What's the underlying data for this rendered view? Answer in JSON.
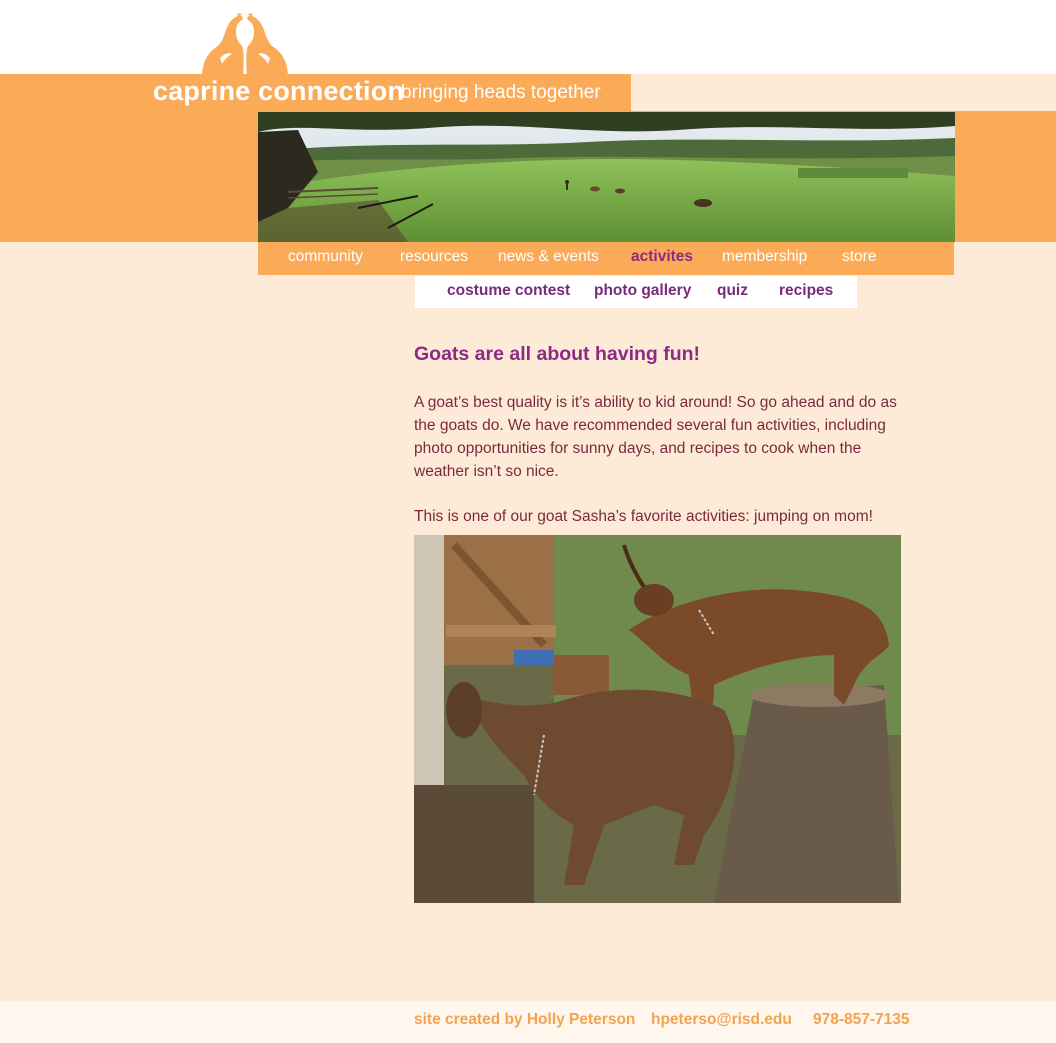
{
  "site": {
    "title": "caprine connection",
    "tagline": "bringing heads together",
    "logo_icon": "twin-goats-logo-icon"
  },
  "main_nav": {
    "items": [
      {
        "label": "community"
      },
      {
        "label": "resources"
      },
      {
        "label": "news & events"
      },
      {
        "label": "activites",
        "active": true
      },
      {
        "label": "membership"
      },
      {
        "label": "store"
      }
    ]
  },
  "sub_nav": {
    "items": [
      {
        "label": "costume contest"
      },
      {
        "label": "photo gallery"
      },
      {
        "label": "quiz"
      },
      {
        "label": "recipes"
      }
    ]
  },
  "content": {
    "heading": "Goats are all about having fun!",
    "paragraph": "A goat’s best quality is it’s ability to kid around! So go ahead and do as the goats do. We have recommended several fun activities, including photo opportunities for sunny days, and recipes to cook when the weather isn’t so nice.",
    "caption": "This is one of our goat Sasha’s favorite activities: jumping on mom!"
  },
  "footer": {
    "credit": "site created by Holly Peterson",
    "email": "hpeterso@risd.edu",
    "phone": "978-857-7135"
  },
  "colors": {
    "orange": "#fbab58",
    "background": "#fdebd7",
    "purple": "#8b2b83",
    "body_text": "#7b2a3d",
    "footer_text": "#f4a34d"
  }
}
